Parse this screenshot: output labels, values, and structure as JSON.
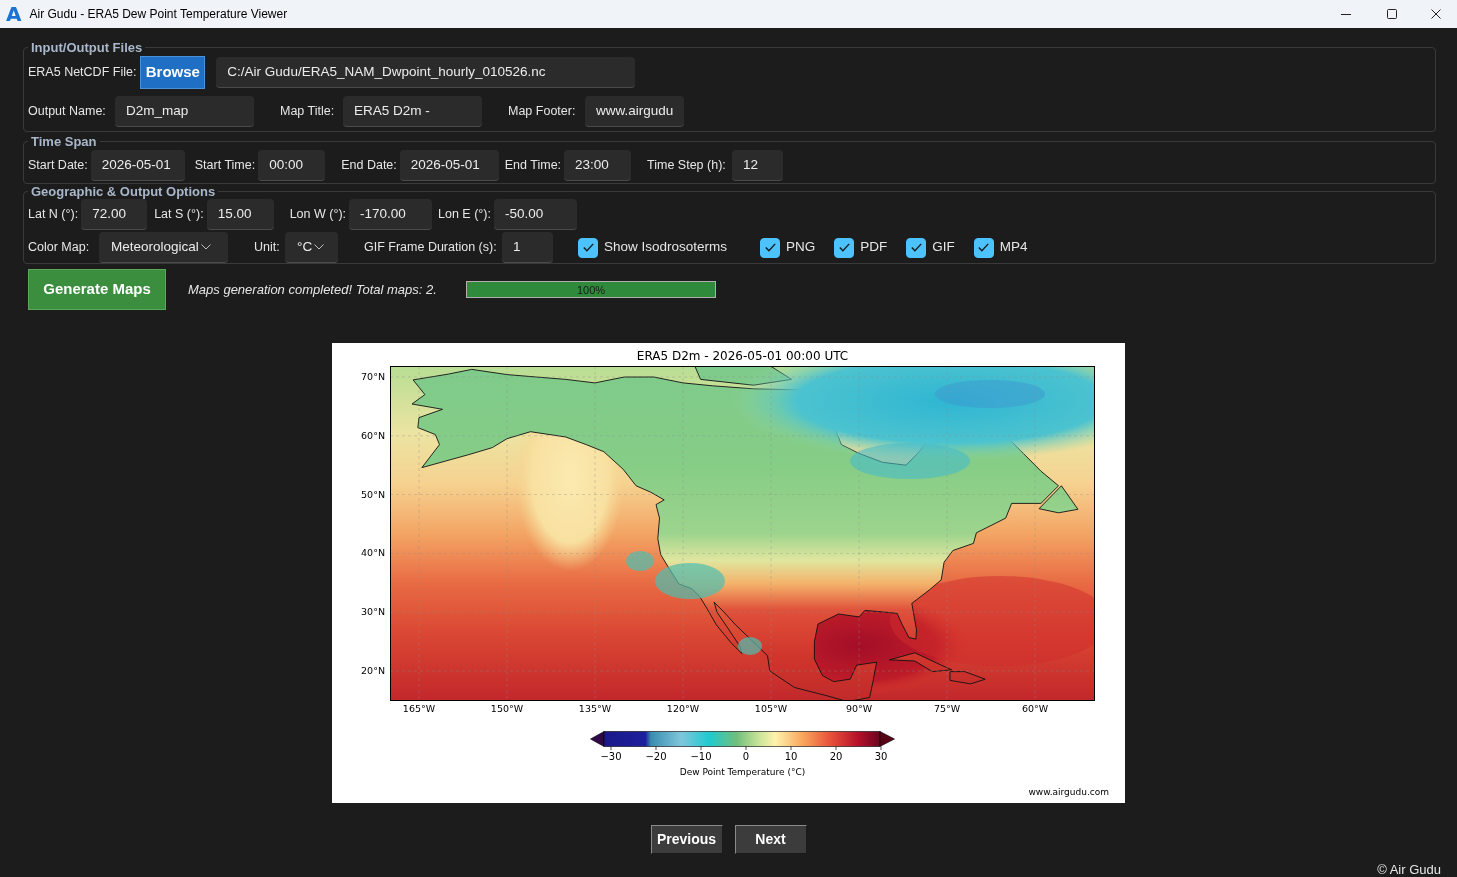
{
  "window": {
    "logo": "A",
    "title": "Air Gudu - ERA5 Dew Point Temperature Viewer"
  },
  "groups": [
    {
      "title": "Input/Output Files",
      "rows": [
        {
          "items": [
            {
              "kind": "file",
              "label": "ERA5 NetCDF File:",
              "button": "Browse",
              "value": "C:/Air Gudu/ERA5_NAM_Dwpoint_hourly_010526.nc"
            }
          ]
        },
        {
          "items": [
            {
              "kind": "field",
              "label": "Output Name:",
              "value": "D2m_map"
            },
            {
              "kind": "field",
              "label": "Map Title:",
              "value": "ERA5 D2m -"
            },
            {
              "kind": "field",
              "label": "Map Footer:",
              "value": "www.airgudu"
            }
          ]
        }
      ]
    },
    {
      "title": "Time Span",
      "rows": [
        {
          "items": [
            {
              "kind": "field",
              "label": "Start Date:",
              "value": "2026-05-01"
            },
            {
              "kind": "field",
              "label": "Start Time:",
              "value": "00:00"
            },
            {
              "kind": "field",
              "label": "End Date:",
              "value": "2026-05-01"
            },
            {
              "kind": "field",
              "label": "End Time:",
              "value": "23:00"
            },
            {
              "kind": "field",
              "label": "Time Step (h):",
              "value": "12"
            }
          ]
        }
      ]
    },
    {
      "title": "Geographic & Output Options",
      "rows": [
        {
          "items": [
            {
              "kind": "field",
              "label": "Lat N (°):",
              "value": "72.00"
            },
            {
              "kind": "field",
              "label": "Lat S (°):",
              "value": "15.00"
            },
            {
              "kind": "field",
              "label": "Lon W (°):",
              "value": "-170.00"
            },
            {
              "kind": "field",
              "label": "Lon E (°):",
              "value": "-50.00"
            }
          ]
        },
        {
          "items": [
            {
              "kind": "dropdown",
              "label": "Color Map:",
              "value": "Meteorological"
            },
            {
              "kind": "dropdown",
              "label": "Unit:",
              "value": "°C"
            },
            {
              "kind": "field",
              "label": "GIF Frame Duration (s):",
              "value": "1"
            },
            {
              "kind": "checkbox",
              "text": "Show Isodrosoterms",
              "checked": true
            },
            {
              "kind": "checkbox",
              "text": "PNG",
              "checked": true
            },
            {
              "kind": "checkbox",
              "text": "PDF",
              "checked": true
            },
            {
              "kind": "checkbox",
              "text": "GIF",
              "checked": true
            },
            {
              "kind": "checkbox",
              "text": "MP4",
              "checked": true
            }
          ]
        }
      ]
    }
  ],
  "actions": {
    "generate_button": "Generate Maps",
    "status": "Maps generation completed! Total maps: 2.",
    "progress": {
      "level": 1,
      "text": "100%"
    }
  },
  "map_figure": {
    "title": "ERA5 D2m - 2026-05-01 00:00 UTC",
    "latitude_labels": [
      "70°N",
      "60°N",
      "50°N",
      "40°N",
      "30°N",
      "20°N"
    ],
    "longitude_labels": [
      "165°W",
      "150°W",
      "135°W",
      "120°W",
      "105°W",
      "90°W",
      "75°W",
      "60°W"
    ],
    "colorbar": {
      "ticks": [
        "−30",
        "−20",
        "−10",
        "0",
        "10",
        "20",
        "30"
      ],
      "label": "Dew Point Temperature (°C)"
    },
    "footer": "www.airgudu.com"
  },
  "navigation": [
    "Previous",
    "Next"
  ],
  "footer": "© Air Gudu"
}
